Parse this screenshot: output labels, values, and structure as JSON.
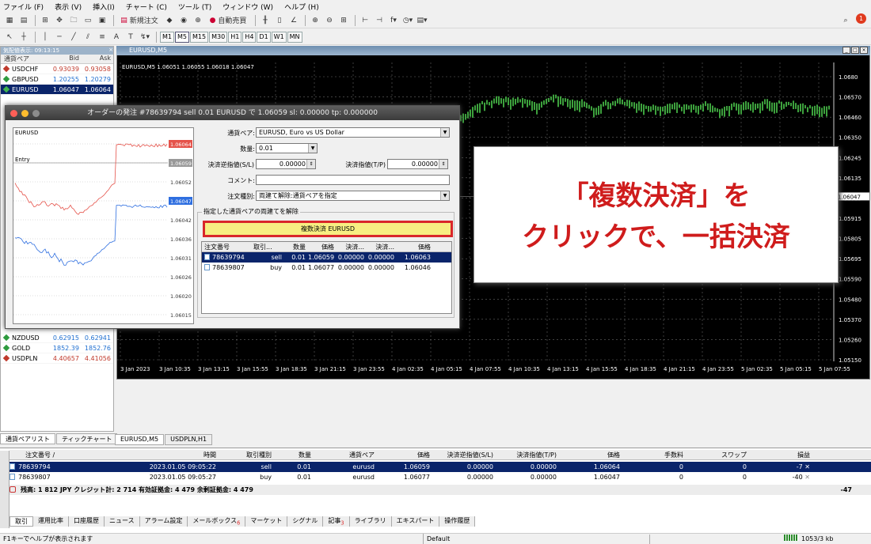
{
  "menu": [
    "ファイル (F)",
    "表示 (V)",
    "挿入(I)",
    "チャート (C)",
    "ツール (T)",
    "ウィンドウ (W)",
    "ヘルプ (H)"
  ],
  "toolbar": {
    "new_order": "新規注文",
    "auto_trade": "自動売買",
    "timeframes": [
      "M1",
      "M5",
      "M15",
      "M30",
      "H1",
      "H4",
      "D1",
      "W1",
      "MN"
    ],
    "active_tf": "M5",
    "text_tool": "A"
  },
  "market_watch": {
    "title": "気配値表示: 09:13:15",
    "headers": [
      "通貨ペア",
      "Bid",
      "Ask"
    ],
    "rows_top": [
      {
        "sym": "USDCHF",
        "bid": "0.93039",
        "ask": "0.93058",
        "dir": "down"
      },
      {
        "sym": "GBPUSD",
        "bid": "1.20255",
        "ask": "1.20279",
        "dir": "up"
      },
      {
        "sym": "EURUSD",
        "bid": "1.06047",
        "ask": "1.06064",
        "dir": "up",
        "selected": true
      }
    ],
    "rows_bottom": [
      {
        "sym": "NZDUSD",
        "bid": "0.62915",
        "ask": "0.62941",
        "dir": "up"
      },
      {
        "sym": "GOLD",
        "bid": "1852.39",
        "ask": "1852.76",
        "dir": "up"
      },
      {
        "sym": "USDPLN",
        "bid": "4.40657",
        "ask": "4.41056",
        "dir": "down"
      }
    ],
    "tabs": [
      "通貨ペアリスト",
      "ティックチャート"
    ]
  },
  "chart": {
    "window_title": "EURUSD,M5",
    "info": "EURUSD,M5  1.06051 1.06055 1.06018 1.06047",
    "yticks": [
      "1.0680",
      "1.06570",
      "1.06460",
      "1.06350",
      "1.06245",
      "1.06135",
      "1.06025",
      "1.05915",
      "1.05805",
      "1.05695",
      "1.05590",
      "1.05480",
      "1.05370",
      "1.05260",
      "1.05150"
    ],
    "current_price": "1.06047",
    "xticks": [
      "3 Jan 2023",
      "3 Jan 10:35",
      "3 Jan 13:15",
      "3 Jan 15:55",
      "3 Jan 18:35",
      "3 Jan 21:15",
      "3 Jan 23:55",
      "4 Jan 02:35",
      "4 Jan 05:15",
      "4 Jan 07:55",
      "4 Jan 10:35",
      "4 Jan 13:15",
      "4 Jan 15:55",
      "4 Jan 18:35",
      "4 Jan 21:15",
      "4 Jan 23:55",
      "5 Jan 02:35",
      "5 Jan 05:15",
      "5 Jan 07:55"
    ],
    "tabs": [
      "EURUSD,M5",
      "USDPLN,H1"
    ]
  },
  "dialog": {
    "title": "オーダーの発注 #78639794 sell 0.01 EURUSD で 1.06059 sl: 0.00000 tp: 0.000000",
    "mini_symbol": "EURUSD",
    "mini_entry": "Entry",
    "mini_ticks": [
      "1.06064",
      "1.06059",
      "1.06052",
      "1.06047",
      "1.06042",
      "1.06036",
      "1.06031",
      "1.06026",
      "1.06020",
      "1.06015"
    ],
    "symbol_label": "通貨ペア:",
    "symbol_value": "EURUSD, Euro vs US Dollar",
    "volume_label": "数量:",
    "volume_value": "0.01",
    "sl_label": "決済逆指値(S/L)",
    "sl_value": "0.00000",
    "tp_label": "決済指値(T/P)",
    "tp_value": "0.00000",
    "comment_label": "コメント:",
    "comment_value": "",
    "type_label": "注文種別:",
    "type_value": "両建て解除:通貨ペアを指定",
    "group_label": "指定した通貨ペアの両建てを解除",
    "close_button": "複数決済 EURUSD",
    "table_headers": [
      "注文番号",
      "取引...",
      "数量",
      "価格",
      "決済...",
      "決済...",
      "価格"
    ],
    "orders": [
      {
        "ticket": "78639794",
        "type": "sell",
        "vol": "0.01",
        "price": "1.06059",
        "sl": "0.00000",
        "tp": "0.00000",
        "cur": "1.06063",
        "selected": true
      },
      {
        "ticket": "78639807",
        "type": "buy",
        "vol": "0.01",
        "price": "1.06077",
        "sl": "0.00000",
        "tp": "0.00000",
        "cur": "1.06046"
      }
    ]
  },
  "callout": {
    "line1": "「複数決済」を",
    "line2": "クリックで、一括決済"
  },
  "terminal": {
    "headers": [
      "注文番号 /",
      "時間",
      "取引種別",
      "数量",
      "通貨ペア",
      "価格",
      "決済逆指値(S/L)",
      "決済指値(T/P)",
      "価格",
      "手数料",
      "スワップ",
      "損益"
    ],
    "orders": [
      {
        "ticket": "78639794",
        "time": "2023.01.05 09:05:22",
        "type": "sell",
        "vol": "0.01",
        "sym": "eurusd",
        "price": "1.06059",
        "sl": "0.00000",
        "tp": "0.00000",
        "cur": "1.06064",
        "comm": "0",
        "swap": "0",
        "pl": "-7",
        "selected": true
      },
      {
        "ticket": "78639807",
        "time": "2023.01.05 09:05:27",
        "type": "buy",
        "vol": "0.01",
        "sym": "eurusd",
        "price": "1.06077",
        "sl": "0.00000",
        "tp": "0.00000",
        "cur": "1.06047",
        "comm": "0",
        "swap": "0",
        "pl": "-40"
      }
    ],
    "summary": "残高: 1 812 JPY  クレジット計: 2 714  有効証拠金: 4 479  余剰証拠金: 4 479",
    "summary_pl": "-47",
    "tabs": [
      "取引",
      "運用比率",
      "口座履歴",
      "ニュース",
      "アラーム設定",
      "メールボックス",
      "マーケット",
      "シグナル",
      "記事",
      "ライブラリ",
      "エキスパート",
      "操作履歴"
    ],
    "mail_badge": "6",
    "article_badge": "3"
  },
  "status": {
    "help": "F1キーでヘルプが表示されます",
    "profile": "Default",
    "traffic": "1053/3 kb"
  }
}
